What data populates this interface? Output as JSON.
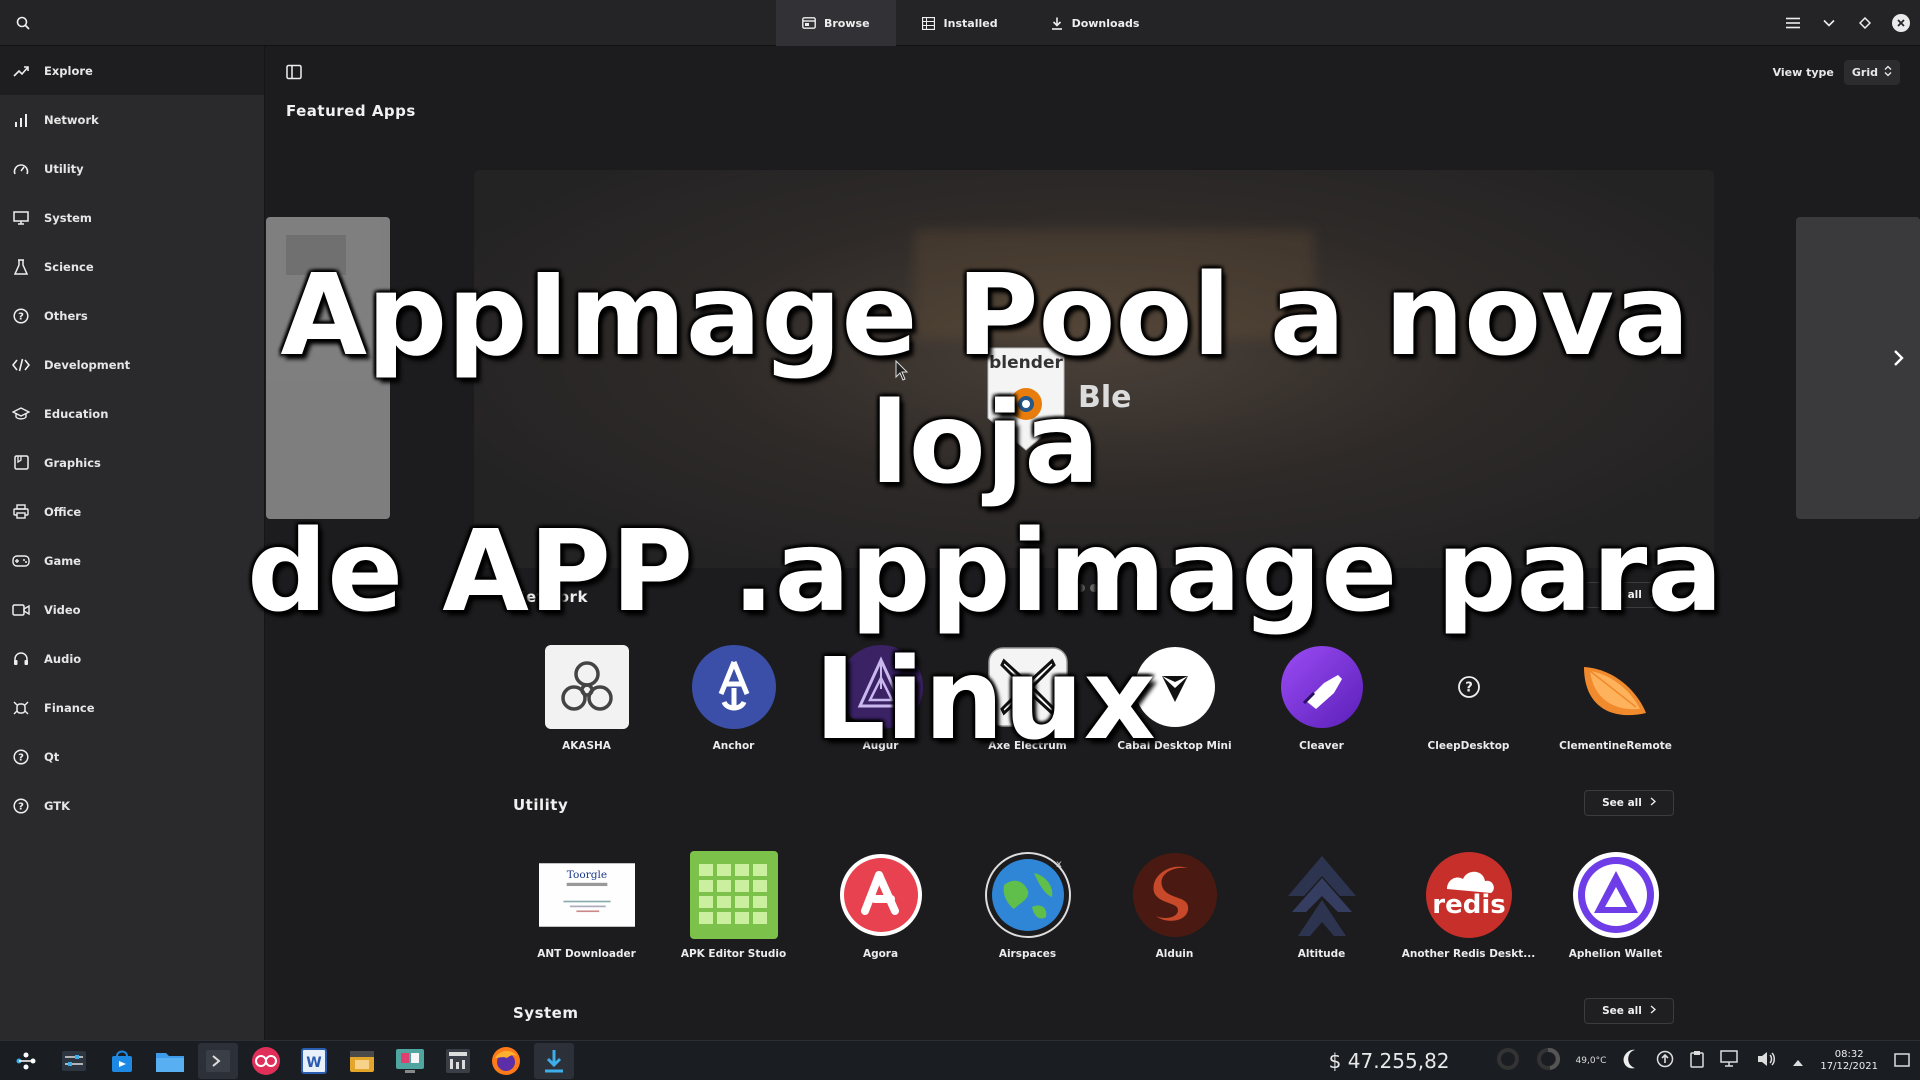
{
  "header": {
    "tabs": [
      {
        "label": "Browse",
        "icon": "browse-icon",
        "active": true
      },
      {
        "label": "Installed",
        "icon": "grid-icon",
        "active": false
      },
      {
        "label": "Downloads",
        "icon": "download-icon",
        "active": false
      }
    ]
  },
  "sidebar": {
    "items": [
      {
        "label": "Explore",
        "icon": "trending-icon"
      },
      {
        "label": "Network",
        "icon": "bar-chart-icon"
      },
      {
        "label": "Utility",
        "icon": "gauge-icon"
      },
      {
        "label": "System",
        "icon": "monitor-icon"
      },
      {
        "label": "Science",
        "icon": "flask-icon"
      },
      {
        "label": "Others",
        "icon": "question-icon"
      },
      {
        "label": "Development",
        "icon": "code-icon"
      },
      {
        "label": "Education",
        "icon": "graduation-cap-icon"
      },
      {
        "label": "Graphics",
        "icon": "image-icon"
      },
      {
        "label": "Office",
        "icon": "printer-icon"
      },
      {
        "label": "Game",
        "icon": "gamepad-icon"
      },
      {
        "label": "Video",
        "icon": "video-camera-icon"
      },
      {
        "label": "Audio",
        "icon": "headphones-icon"
      },
      {
        "label": "Finance",
        "icon": "bug-icon"
      },
      {
        "label": "Qt",
        "icon": "question-icon"
      },
      {
        "label": "GTK",
        "icon": "question-icon"
      }
    ]
  },
  "main": {
    "view_type_label": "View type",
    "view_type_value": "Grid",
    "featured_title": "Featured Apps",
    "featured_banner_badge": "blender",
    "featured_banner_word": "Ble",
    "see_all_label": "See all",
    "sections": [
      {
        "title": "Network",
        "apps": [
          "AKASHA",
          "Anchor",
          "Augur",
          "Axe Electrum",
          "Cabal Desktop Mini",
          "Cleaver",
          "CleepDesktop",
          "ClementineRemote"
        ]
      },
      {
        "title": "Utility",
        "apps": [
          "ANT Downloader",
          "APK Editor Studio",
          "Agora",
          "Airspaces",
          "Alduin",
          "Altitude",
          "Another Redis Deskt...",
          "Aphelion Wallet"
        ]
      },
      {
        "title": "System",
        "apps": []
      }
    ],
    "toorgle_text": "Toorgle",
    "redis_text": "redis"
  },
  "overlay": {
    "headline_lines": [
      "AppImage Pool a nova loja",
      "de APP .appimage para",
      "Linux"
    ]
  },
  "taskbar": {
    "price": "$ 47.255,82",
    "temperature": "49,0°C",
    "time": "08:32",
    "date": "17/12/2021"
  },
  "colors": {
    "accent_purple": "#7b3fe4",
    "firefox_orange": "#ff7a18",
    "redis_red": "#c7302a"
  }
}
